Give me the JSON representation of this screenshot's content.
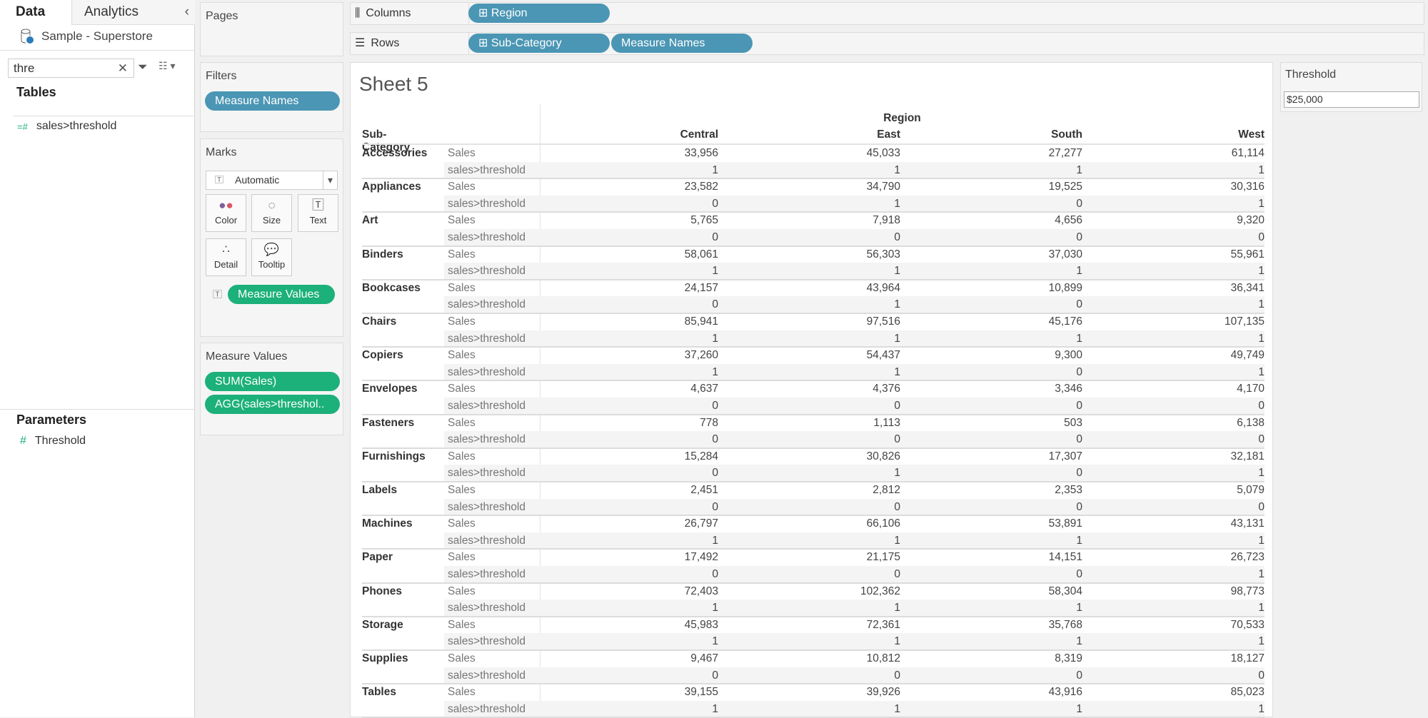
{
  "left_pane": {
    "tabs": [
      "Data",
      "Analytics"
    ],
    "datasource": "Sample - Superstore",
    "search_value": "thre",
    "tables_heading": "Tables",
    "table_field": "sales>threshold",
    "parameters_heading": "Parameters",
    "parameter": "Threshold"
  },
  "cards": {
    "pages": "Pages",
    "filters": "Filters",
    "filter_pill": "Measure Names",
    "marks": "Marks",
    "mark_type": "Automatic",
    "mark_buttons": [
      "Color",
      "Size",
      "Text",
      "Detail",
      "Tooltip"
    ],
    "marks_pill": "Measure Values",
    "measure_values_title": "Measure Values",
    "measure_values_pills": [
      "SUM(Sales)",
      "AGG(sales>threshol.."
    ]
  },
  "shelves": {
    "columns_label": "Columns",
    "columns_pills": [
      "Region"
    ],
    "rows_label": "Rows",
    "rows_pills": [
      "Sub-Category",
      "Measure Names"
    ]
  },
  "sheet": {
    "title": "Sheet 5",
    "region_header": "Region",
    "row_header": "Sub-Category",
    "columns": [
      "Central",
      "East",
      "South",
      "West"
    ],
    "measures": [
      "Sales",
      "sales>threshold"
    ],
    "rows": [
      {
        "name": "Accessories",
        "sales": [
          "33,956",
          "45,033",
          "27,277",
          "61,114"
        ],
        "flag": [
          "1",
          "1",
          "1",
          "1"
        ]
      },
      {
        "name": "Appliances",
        "sales": [
          "23,582",
          "34,790",
          "19,525",
          "30,316"
        ],
        "flag": [
          "0",
          "1",
          "0",
          "1"
        ]
      },
      {
        "name": "Art",
        "sales": [
          "5,765",
          "7,918",
          "4,656",
          "9,320"
        ],
        "flag": [
          "0",
          "0",
          "0",
          "0"
        ]
      },
      {
        "name": "Binders",
        "sales": [
          "58,061",
          "56,303",
          "37,030",
          "55,961"
        ],
        "flag": [
          "1",
          "1",
          "1",
          "1"
        ]
      },
      {
        "name": "Bookcases",
        "sales": [
          "24,157",
          "43,964",
          "10,899",
          "36,341"
        ],
        "flag": [
          "0",
          "1",
          "0",
          "1"
        ]
      },
      {
        "name": "Chairs",
        "sales": [
          "85,941",
          "97,516",
          "45,176",
          "107,135"
        ],
        "flag": [
          "1",
          "1",
          "1",
          "1"
        ]
      },
      {
        "name": "Copiers",
        "sales": [
          "37,260",
          "54,437",
          "9,300",
          "49,749"
        ],
        "flag": [
          "1",
          "1",
          "0",
          "1"
        ]
      },
      {
        "name": "Envelopes",
        "sales": [
          "4,637",
          "4,376",
          "3,346",
          "4,170"
        ],
        "flag": [
          "0",
          "0",
          "0",
          "0"
        ]
      },
      {
        "name": "Fasteners",
        "sales": [
          "778",
          "1,113",
          "503",
          "6,138"
        ],
        "flag": [
          "0",
          "0",
          "0",
          "0"
        ]
      },
      {
        "name": "Furnishings",
        "sales": [
          "15,284",
          "30,826",
          "17,307",
          "32,181"
        ],
        "flag": [
          "0",
          "1",
          "0",
          "1"
        ]
      },
      {
        "name": "Labels",
        "sales": [
          "2,451",
          "2,812",
          "2,353",
          "5,079"
        ],
        "flag": [
          "0",
          "0",
          "0",
          "0"
        ]
      },
      {
        "name": "Machines",
        "sales": [
          "26,797",
          "66,106",
          "53,891",
          "43,131"
        ],
        "flag": [
          "1",
          "1",
          "1",
          "1"
        ]
      },
      {
        "name": "Paper",
        "sales": [
          "17,492",
          "21,175",
          "14,151",
          "26,723"
        ],
        "flag": [
          "0",
          "0",
          "0",
          "1"
        ]
      },
      {
        "name": "Phones",
        "sales": [
          "72,403",
          "102,362",
          "58,304",
          "98,773"
        ],
        "flag": [
          "1",
          "1",
          "1",
          "1"
        ]
      },
      {
        "name": "Storage",
        "sales": [
          "45,983",
          "72,361",
          "35,768",
          "70,533"
        ],
        "flag": [
          "1",
          "1",
          "1",
          "1"
        ]
      },
      {
        "name": "Supplies",
        "sales": [
          "9,467",
          "10,812",
          "8,319",
          "18,127"
        ],
        "flag": [
          "0",
          "0",
          "0",
          "0"
        ]
      },
      {
        "name": "Tables",
        "sales": [
          "39,155",
          "39,926",
          "43,916",
          "85,023"
        ],
        "flag": [
          "1",
          "1",
          "1",
          "1"
        ]
      }
    ]
  },
  "threshold": {
    "title": "Threshold",
    "value": "$25,000"
  },
  "colors": {
    "blue_pill": "#4b96b4",
    "green_pill": "#1cb07a"
  }
}
